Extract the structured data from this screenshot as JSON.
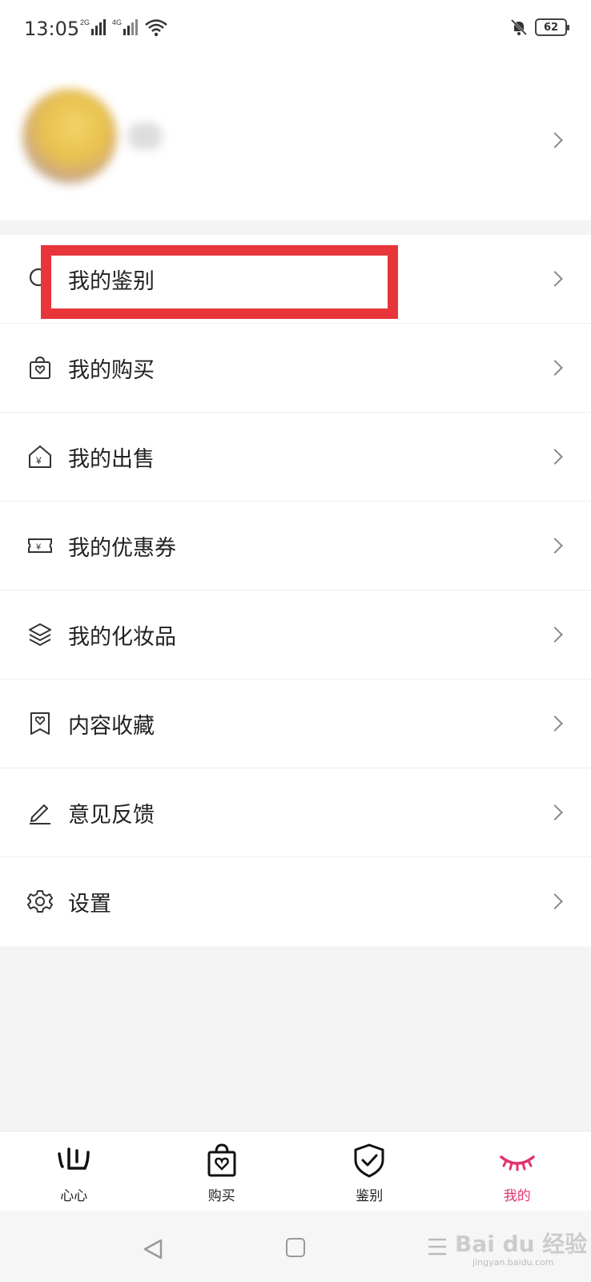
{
  "status_bar": {
    "time": "13:05",
    "signal1_label": "2G",
    "signal2_label": "4G",
    "battery": "62"
  },
  "profile": {
    "name": ""
  },
  "menu": {
    "items": [
      {
        "label": "我的鉴别",
        "icon": "search-icon"
      },
      {
        "label": "我的购买",
        "icon": "shopping-bag-icon"
      },
      {
        "label": "我的出售",
        "icon": "sell-house-icon"
      },
      {
        "label": "我的优惠券",
        "icon": "coupon-icon"
      },
      {
        "label": "我的化妆品",
        "icon": "layers-icon"
      },
      {
        "label": "内容收藏",
        "icon": "bookmark-heart-icon"
      },
      {
        "label": "意见反馈",
        "icon": "edit-icon"
      },
      {
        "label": "设置",
        "icon": "gear-icon"
      }
    ]
  },
  "bottom_nav": {
    "items": [
      {
        "label": "心心",
        "icon": "heart-logo-icon",
        "active": false
      },
      {
        "label": "购买",
        "icon": "shopping-bag-icon",
        "active": false
      },
      {
        "label": "鉴别",
        "icon": "shield-check-icon",
        "active": false
      },
      {
        "label": "我的",
        "icon": "eyelash-icon",
        "active": true
      }
    ]
  },
  "watermark": {
    "text": "Bai du 经验",
    "sub": "jingyan.baidu.com"
  },
  "colors": {
    "highlight": "#e8353a",
    "active_tab": "#e2336b"
  }
}
